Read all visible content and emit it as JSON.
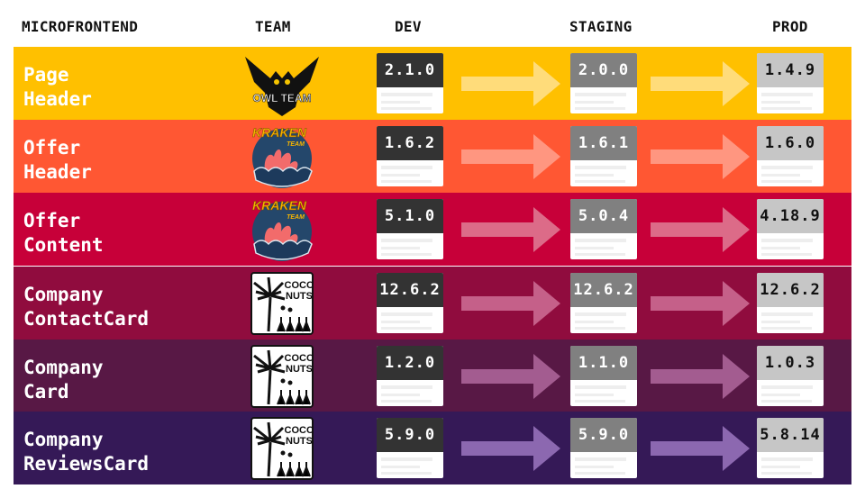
{
  "headers": {
    "microfrontend": "MICROFRONTEND",
    "team": "TEAM",
    "dev": "DEV",
    "staging": "STAGING",
    "prod": "PROD"
  },
  "rows": [
    {
      "name": "Page\nHeader",
      "team": "OWL TEAM",
      "team_icon": "owl-team-logo",
      "dev": "2.1.0",
      "staging": "2.0.0",
      "prod": "1.4.9",
      "bg": "#ffc000",
      "arrow": "#ffdc7a"
    },
    {
      "name": "Offer\nHeader",
      "team": "KRAKEN TEAM",
      "team_icon": "kraken-team-logo",
      "dev": "1.6.2",
      "staging": "1.6.1",
      "prod": "1.6.0",
      "bg": "#ff5733",
      "arrow": "#ff9680"
    },
    {
      "name": "Offer\nContent",
      "team": "KRAKEN TEAM",
      "team_icon": "kraken-team-logo",
      "dev": "5.1.0",
      "staging": "5.0.4",
      "prod": "4.18.9",
      "bg": "#c70039",
      "arrow": "#dc6b88"
    },
    {
      "name": "Company\nContactCard",
      "team": "COCO NUTS",
      "team_icon": "coconuts-team-logo",
      "dev": "12.6.2",
      "staging": "12.6.2",
      "prod": "12.6.2",
      "bg": "#900c3e",
      "arrow": "#c56089"
    },
    {
      "name": "Company\nCard",
      "team": "COCO NUTS",
      "team_icon": "coconuts-team-logo",
      "dev": "1.2.0",
      "staging": "1.1.0",
      "prod": "1.0.3",
      "bg": "#581845",
      "arrow": "#a35c90"
    },
    {
      "name": "Company\nReviewsCard",
      "team": "COCO NUTS",
      "team_icon": "coconuts-team-logo",
      "dev": "5.9.0",
      "staging": "5.9.0",
      "prod": "5.8.14",
      "bg": "#351957",
      "arrow": "#8c68b0"
    }
  ]
}
